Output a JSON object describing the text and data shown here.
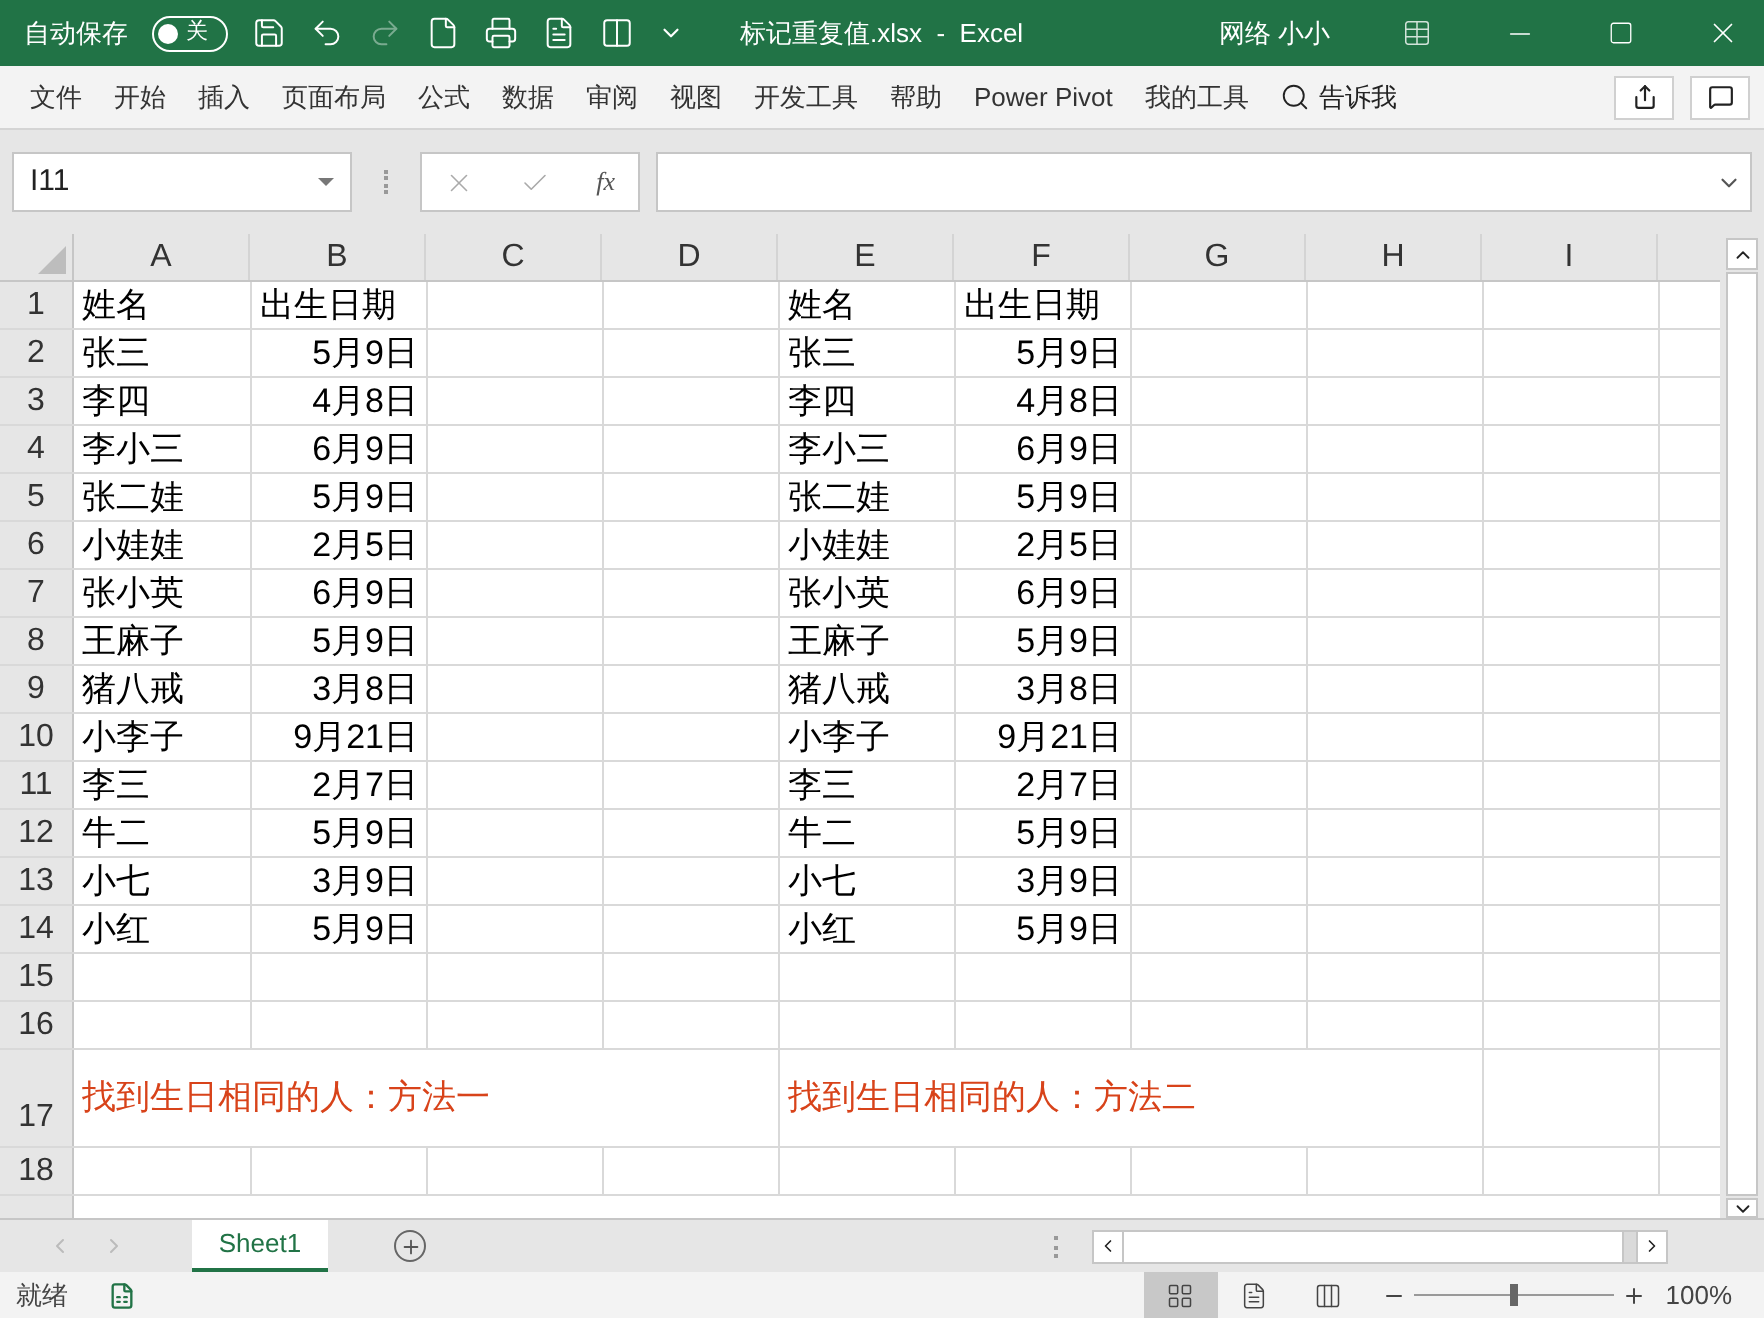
{
  "title_bar": {
    "autosave_label": "自动保存",
    "autosave": {
      "on": false,
      "label": "关"
    },
    "title": "标记重复值.xlsx  -  Excel",
    "user": "网络 小小",
    "redo_disabled": true
  },
  "ribbon_tabs": [
    {
      "label": "文件"
    },
    {
      "label": "开始"
    },
    {
      "label": "插入"
    },
    {
      "label": "页面布局"
    },
    {
      "label": "公式"
    },
    {
      "label": "数据"
    },
    {
      "label": "审阅"
    },
    {
      "label": "视图"
    },
    {
      "label": "开发工具"
    },
    {
      "label": "帮助"
    },
    {
      "label": "Power Pivot"
    },
    {
      "label": "我的工具"
    }
  ],
  "tell_me": "告诉我",
  "formula_bar": {
    "name_box": "I11",
    "fx": "fx"
  },
  "sheet": {
    "columns": [
      "A",
      "B",
      "C",
      "D",
      "E",
      "F",
      "G",
      "H",
      "I"
    ],
    "rows": [
      {
        "header": "1",
        "cells": [
          {
            "kind": "text",
            "text": "姓名"
          },
          {
            "kind": "text",
            "text": "出生日期"
          },
          "",
          "",
          {
            "kind": "text",
            "text": "姓名"
          },
          {
            "kind": "text",
            "text": "出生日期"
          }
        ]
      },
      {
        "header": "2",
        "cells": [
          {
            "kind": "text",
            "text": "张三"
          },
          {
            "kind": "date",
            "text": "5月9日"
          },
          "",
          "",
          {
            "kind": "text",
            "text": "张三"
          },
          {
            "kind": "date",
            "text": "5月9日"
          }
        ]
      },
      {
        "header": "3",
        "cells": [
          {
            "kind": "text",
            "text": "李四"
          },
          {
            "kind": "date",
            "text": "4月8日"
          },
          "",
          "",
          {
            "kind": "text",
            "text": "李四"
          },
          {
            "kind": "date",
            "text": "4月8日"
          }
        ]
      },
      {
        "header": "4",
        "cells": [
          {
            "kind": "text",
            "text": "李小三"
          },
          {
            "kind": "date",
            "text": "6月9日"
          },
          "",
          "",
          {
            "kind": "text",
            "text": "李小三"
          },
          {
            "kind": "date",
            "text": "6月9日"
          }
        ]
      },
      {
        "header": "5",
        "cells": [
          {
            "kind": "text",
            "text": "张二娃"
          },
          {
            "kind": "date",
            "text": "5月9日"
          },
          "",
          "",
          {
            "kind": "text",
            "text": "张二娃"
          },
          {
            "kind": "date",
            "text": "5月9日"
          }
        ]
      },
      {
        "header": "6",
        "cells": [
          {
            "kind": "text",
            "text": "小娃娃"
          },
          {
            "kind": "date",
            "text": "2月5日"
          },
          "",
          "",
          {
            "kind": "text",
            "text": "小娃娃"
          },
          {
            "kind": "date",
            "text": "2月5日"
          }
        ]
      },
      {
        "header": "7",
        "cells": [
          {
            "kind": "text",
            "text": "张小英"
          },
          {
            "kind": "date",
            "text": "6月9日"
          },
          "",
          "",
          {
            "kind": "text",
            "text": "张小英"
          },
          {
            "kind": "date",
            "text": "6月9日"
          }
        ]
      },
      {
        "header": "8",
        "cells": [
          {
            "kind": "text",
            "text": "王麻子"
          },
          {
            "kind": "date",
            "text": "5月9日"
          },
          "",
          "",
          {
            "kind": "text",
            "text": "王麻子"
          },
          {
            "kind": "date",
            "text": "5月9日"
          }
        ]
      },
      {
        "header": "9",
        "cells": [
          {
            "kind": "text",
            "text": "猪八戒"
          },
          {
            "kind": "date",
            "text": "3月8日"
          },
          "",
          "",
          {
            "kind": "text",
            "text": "猪八戒"
          },
          {
            "kind": "date",
            "text": "3月8日"
          }
        ]
      },
      {
        "header": "10",
        "cells": [
          {
            "kind": "text",
            "text": "小李子"
          },
          {
            "kind": "date",
            "text": "9月21日"
          },
          "",
          "",
          {
            "kind": "text",
            "text": "小李子"
          },
          {
            "kind": "date",
            "text": "9月21日"
          }
        ]
      },
      {
        "header": "11",
        "cells": [
          {
            "kind": "text",
            "text": "李三"
          },
          {
            "kind": "date",
            "text": "2月7日"
          },
          "",
          "",
          {
            "kind": "text",
            "text": "李三"
          },
          {
            "kind": "date",
            "text": "2月7日"
          }
        ]
      },
      {
        "header": "12",
        "cells": [
          {
            "kind": "text",
            "text": "牛二"
          },
          {
            "kind": "date",
            "text": "5月9日"
          },
          "",
          "",
          {
            "kind": "text",
            "text": "牛二"
          },
          {
            "kind": "date",
            "text": "5月9日"
          }
        ]
      },
      {
        "header": "13",
        "cells": [
          {
            "kind": "text",
            "text": "小七"
          },
          {
            "kind": "date",
            "text": "3月9日"
          },
          "",
          "",
          {
            "kind": "text",
            "text": "小七"
          },
          {
            "kind": "date",
            "text": "3月9日"
          }
        ]
      },
      {
        "header": "14",
        "cells": [
          {
            "kind": "text",
            "text": "小红"
          },
          {
            "kind": "date",
            "text": "5月9日"
          },
          "",
          "",
          {
            "kind": "text",
            "text": "小红"
          },
          {
            "kind": "date",
            "text": "5月9日"
          }
        ]
      },
      {
        "header": "15",
        "cells": []
      },
      {
        "header": "16",
        "cells": []
      },
      {
        "header": "17",
        "tall": true,
        "cells": [
          {
            "kind": "note",
            "text": "找到生日相同的人：方法一"
          },
          "",
          "",
          "",
          {
            "kind": "note",
            "text": "找到生日相同的人：方法二"
          }
        ]
      },
      {
        "header": "18",
        "cells": []
      }
    ]
  },
  "sheet_tabs": [
    {
      "label": "Sheet1",
      "selected": true
    }
  ],
  "status_bar": {
    "status": "就绪",
    "views": [
      {
        "kind": "normal",
        "selected": true
      },
      {
        "kind": "page_layout",
        "selected": false
      },
      {
        "kind": "page_break",
        "selected": false
      }
    ],
    "zoom": {
      "level": 0.5,
      "reading": "100%"
    }
  }
}
